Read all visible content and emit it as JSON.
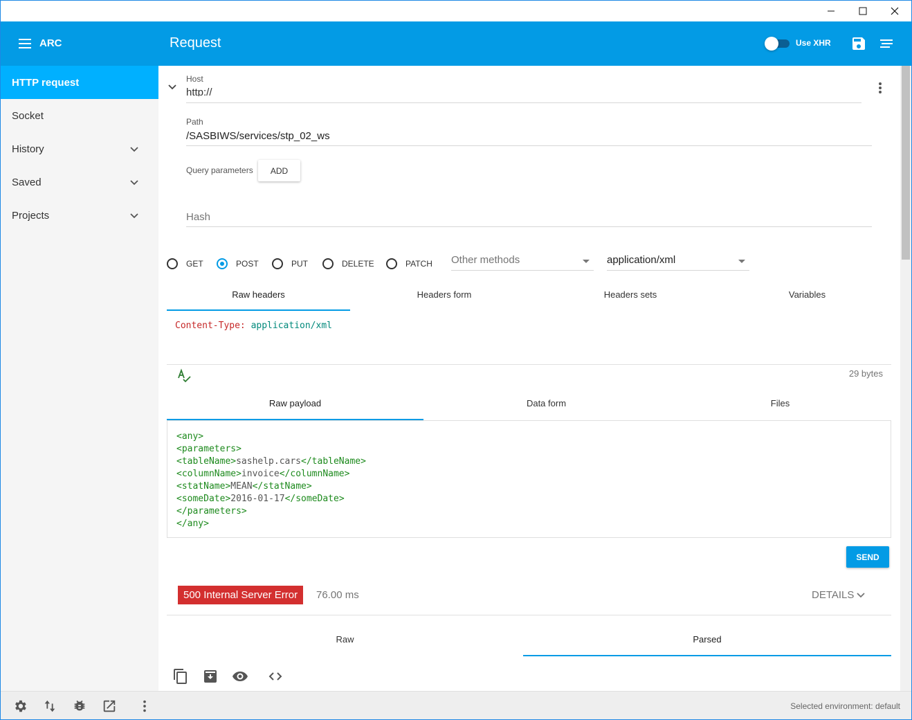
{
  "window": {
    "minimize_glyph": "—",
    "maximize_glyph": "☐",
    "close_glyph": "✕"
  },
  "header": {
    "app_name": "ARC",
    "title": "Request",
    "use_xhr_label": "Use XHR",
    "accent_color": "#039be5"
  },
  "sidebar": {
    "items": [
      {
        "label": "HTTP request",
        "active": true
      },
      {
        "label": "Socket"
      },
      {
        "label": "History",
        "icon": "chevron-down-icon"
      },
      {
        "label": "Saved",
        "icon": "chevron-down-icon"
      },
      {
        "label": "Projects",
        "icon": "chevron-down-icon"
      }
    ]
  },
  "url": {
    "host_label": "Host",
    "host_value": "http://",
    "path_label": "Path",
    "path_value": "/SASBIWS/services/stp_02_ws",
    "query_label": "Query parameters",
    "add_label": "ADD",
    "hash_placeholder": "Hash"
  },
  "methods": {
    "options": [
      "GET",
      "POST",
      "PUT",
      "DELETE",
      "PATCH"
    ],
    "selected": "POST",
    "other_placeholder": "Other methods",
    "content_type": "application/xml"
  },
  "headers_tabs": [
    "Raw headers",
    "Headers form",
    "Headers sets",
    "Variables"
  ],
  "headers_editor": {
    "key": "Content-Type:",
    "value": "application/xml",
    "size": "29 bytes"
  },
  "payload_tabs": [
    "Raw payload",
    "Data form",
    "Files"
  ],
  "payload_lines": [
    {
      "open": "<any>",
      "text": "",
      "close": ""
    },
    {
      "open": "<parameters>",
      "text": "",
      "close": ""
    },
    {
      "open": "<tableName>",
      "text": "sashelp.cars",
      "close": "</tableName>"
    },
    {
      "open": "<columnName>",
      "text": "invoice",
      "close": "</columnName>"
    },
    {
      "open": "<statName>",
      "text": "MEAN",
      "close": "</statName>"
    },
    {
      "open": "<someDate>",
      "text": "2016-01-17",
      "close": "</someDate>"
    },
    {
      "open": "</parameters>",
      "text": "",
      "close": ""
    },
    {
      "open": "</any>",
      "text": "",
      "close": ""
    }
  ],
  "send_label": "SEND",
  "response": {
    "status": "500 Internal Server Error",
    "status_color": "#d32f2f",
    "time": "76.00 ms",
    "details_label": "DETAILS",
    "tabs": [
      "Raw",
      "Parsed"
    ],
    "active_tab": "Parsed",
    "actions": [
      "copy-icon",
      "save-icon",
      "preview-icon",
      "code-icon"
    ]
  },
  "footer": {
    "environment": "Selected environment: default",
    "icons": [
      "settings-icon",
      "sort-icon",
      "bug-icon",
      "open-external-icon",
      "more-vert-icon"
    ]
  }
}
